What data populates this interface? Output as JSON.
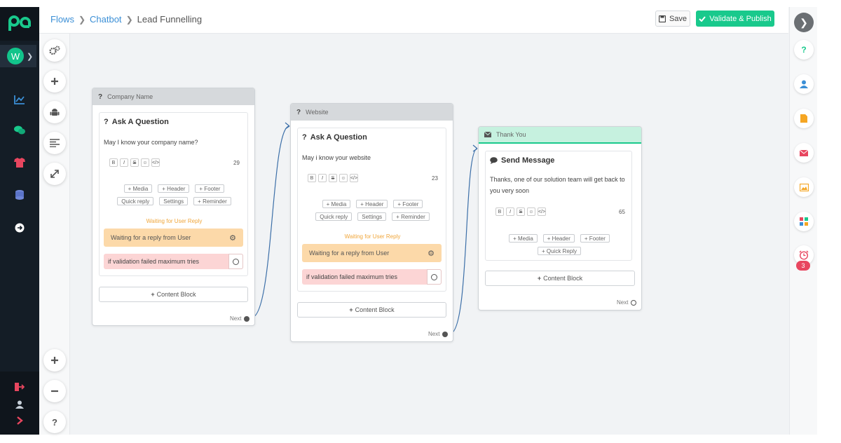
{
  "breadcrumb": {
    "flows": "Flows",
    "chatbot": "Chatbot",
    "current": "Lead Funnelling"
  },
  "toolbar": {
    "save_label": "Save",
    "publish_label": "Validate & Publish"
  },
  "nav": {
    "avatar_initial": "W"
  },
  "rail": {
    "help_label": "?",
    "alarm_badge": "3"
  },
  "tools": {
    "help_label": "?"
  },
  "nodes": [
    {
      "title": "Company Name",
      "block_title": "Ask A Question",
      "message": "May I know your company name?",
      "char_count": "29",
      "chips": [
        "+ Media",
        "+ Header",
        "+ Footer",
        "Quick reply",
        "Settings",
        "+ Reminder"
      ],
      "waiting_label": "Waiting for User Reply",
      "waiting_text": "Waiting for a reply from User",
      "fail_text": "if validation failed maximum tries",
      "content_block": "Content Block",
      "next_label": "Next"
    },
    {
      "title": "Website",
      "block_title": "Ask A Question",
      "message": "May i know your website",
      "char_count": "23",
      "chips": [
        "+ Media",
        "+ Header",
        "+ Footer",
        "Quick reply",
        "Settings",
        "+ Reminder"
      ],
      "waiting_label": "Waiting for User Reply",
      "waiting_text": "Waiting for a reply from User",
      "fail_text": "if validation failed maximum tries",
      "content_block": "Content Block",
      "next_label": "Next"
    },
    {
      "title": "Thank You",
      "block_title": "Send Message",
      "message": "Thanks, one of our solution team will get back to you very soon",
      "char_count": "65",
      "chips": [
        "+ Media",
        "+ Header",
        "+ Footer",
        "+ Quick Reply"
      ],
      "content_block": "Content Block",
      "next_label": "Next"
    }
  ],
  "colors": {
    "accent": "#19c98c",
    "link": "#3b8fd6",
    "waiting": "#fcd9a9",
    "fail": "#fcd5d5",
    "sidebar": "#141d26"
  },
  "icons": {
    "nav": [
      "analytics-icon",
      "chat-icon",
      "shirt-icon",
      "database-icon",
      "arrow-circle-right-icon",
      "logout-icon",
      "user-icon",
      "chevron-right-icon"
    ],
    "rail": [
      "help-icon",
      "user-icon",
      "document-icon",
      "mail-icon",
      "image-icon",
      "apps-icon",
      "alarm-clock-icon"
    ],
    "tools": [
      "gears-icon",
      "plus-icon",
      "android-icon",
      "align-left-icon",
      "expand-icon",
      "zoom-in-icon",
      "zoom-out-icon",
      "help-icon"
    ]
  }
}
